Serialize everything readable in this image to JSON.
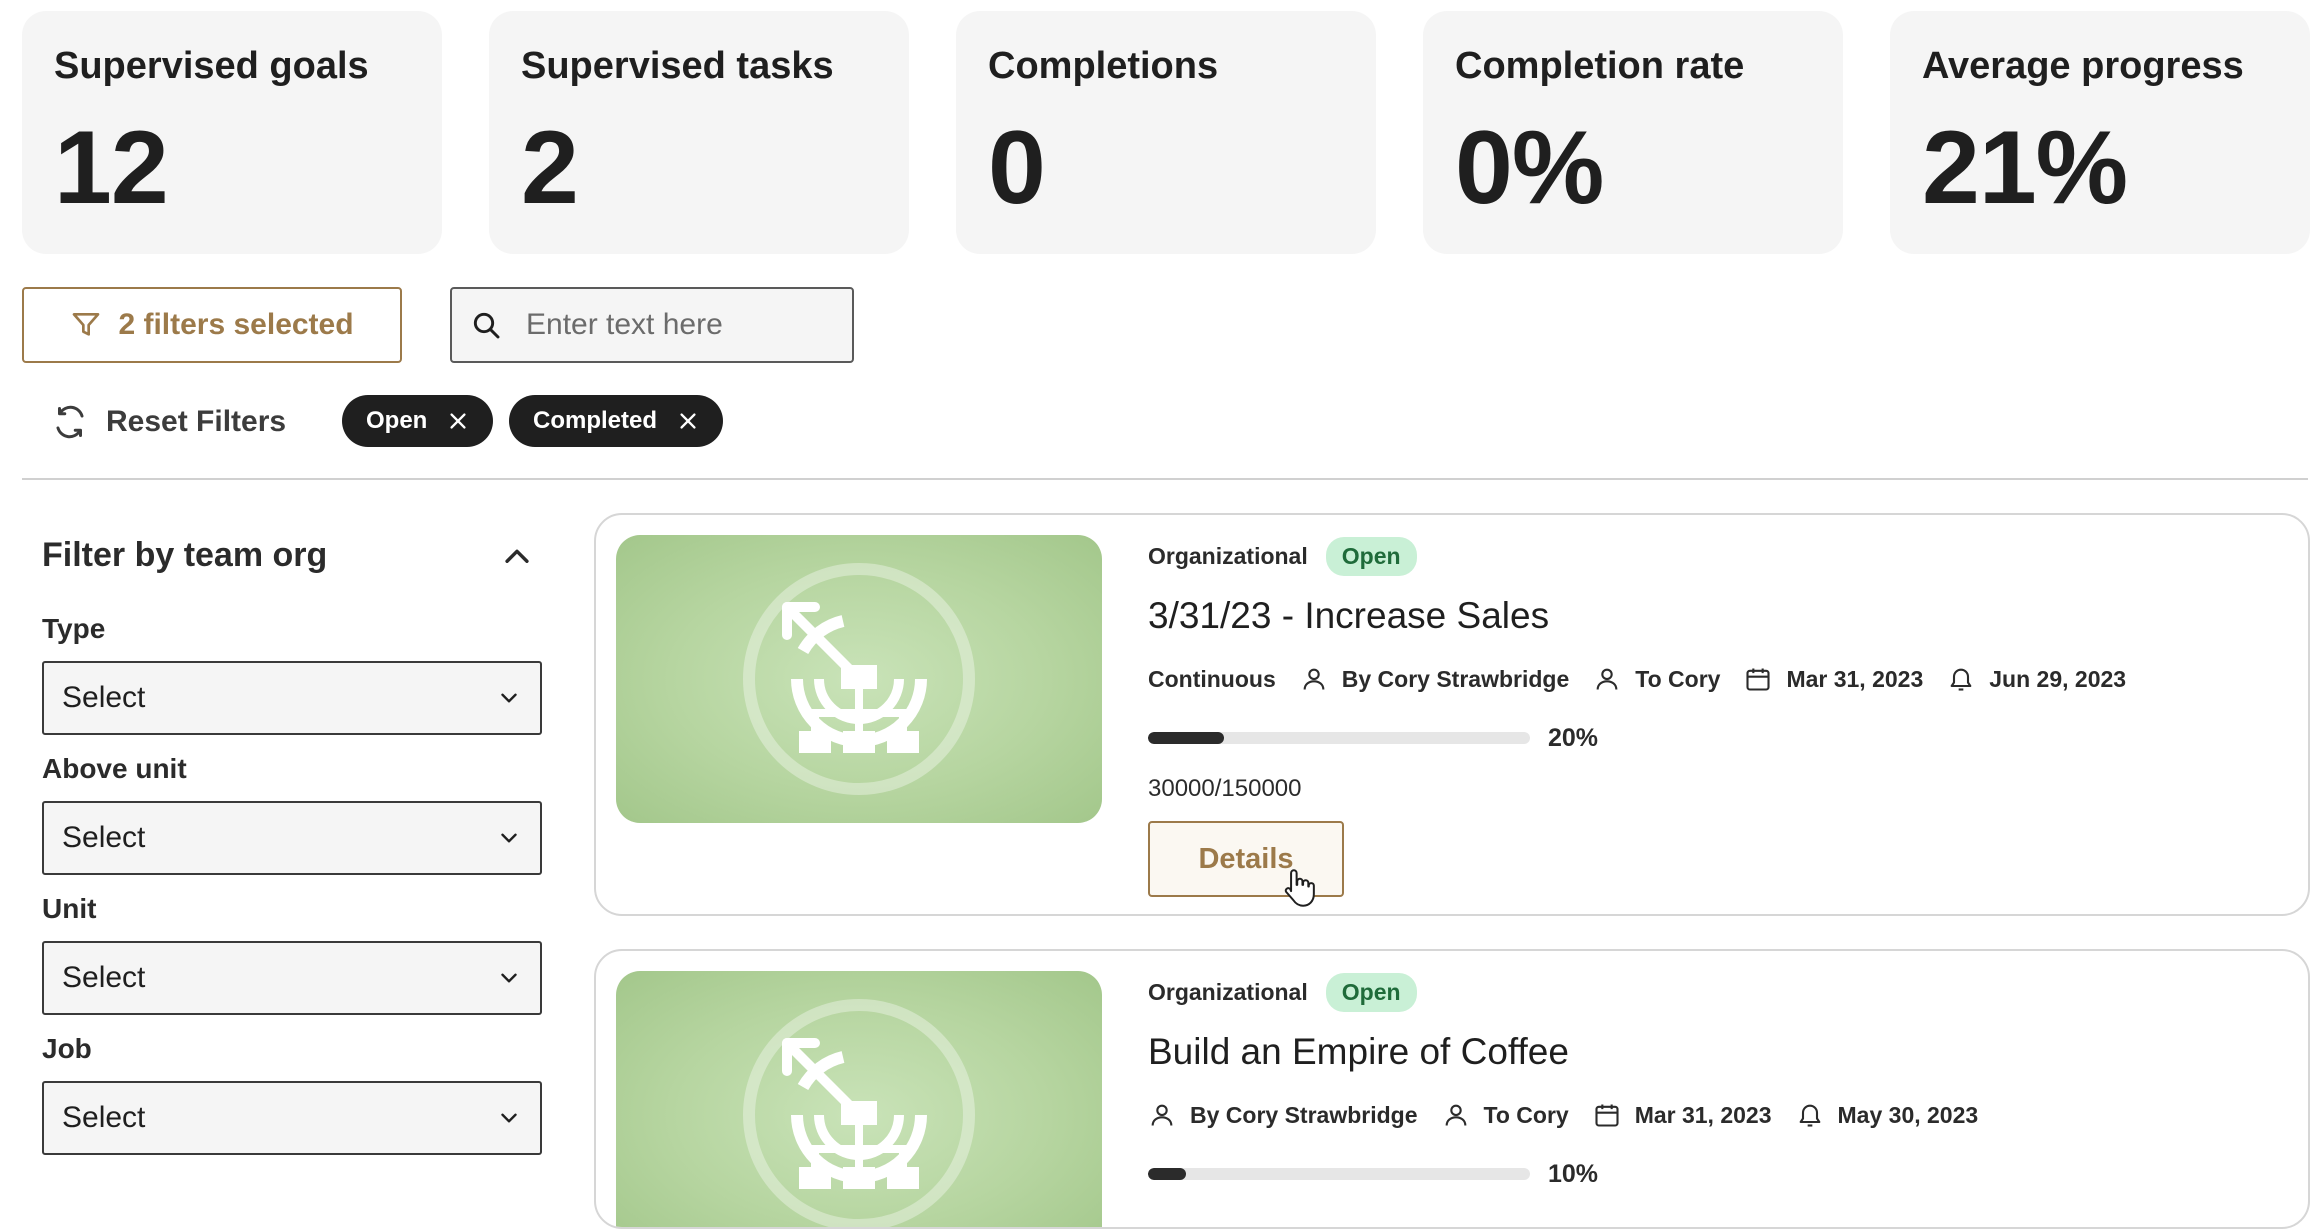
{
  "stats": [
    {
      "label": "Supervised goals",
      "value": "12"
    },
    {
      "label": "Supervised tasks",
      "value": "2"
    },
    {
      "label": "Completions",
      "value": "0"
    },
    {
      "label": "Completion rate",
      "value": "0%"
    },
    {
      "label": "Average progress",
      "value": "21%"
    }
  ],
  "toolbar": {
    "filter_label": "2 filters selected",
    "search_placeholder": "Enter text here",
    "search_value": "",
    "reset_label": "Reset Filters",
    "chips": [
      {
        "label": "Open"
      },
      {
        "label": "Completed"
      }
    ]
  },
  "sidebar": {
    "title": "Filter by team org",
    "filters": [
      {
        "label": "Type",
        "value": "Select"
      },
      {
        "label": "Above unit",
        "value": "Select"
      },
      {
        "label": "Unit",
        "value": "Select"
      },
      {
        "label": "Job",
        "value": "Select"
      }
    ]
  },
  "goals": [
    {
      "category": "Organizational",
      "status": "Open",
      "title": "3/31/23 - Increase Sales",
      "frequency": "Continuous",
      "by": "By Cory Strawbridge",
      "to": "To Cory",
      "start_date": "Mar 31, 2023",
      "reminder_date": "Jun 29, 2023",
      "progress": 20,
      "progress_label": "20%",
      "ratio": "30000/150000",
      "details_label": "Details"
    },
    {
      "category": "Organizational",
      "status": "Open",
      "title": "Build an Empire of Coffee",
      "by": "By Cory Strawbridge",
      "to": "To Cory",
      "start_date": "Mar 31, 2023",
      "reminder_date": "May 30, 2023",
      "progress": 10,
      "progress_label": "10%"
    }
  ],
  "colors": {
    "accent": "#9c7a4a",
    "badge_bg": "#c9f0d6",
    "badge_text": "#1f6b3a",
    "dark": "#1f1f1f"
  }
}
